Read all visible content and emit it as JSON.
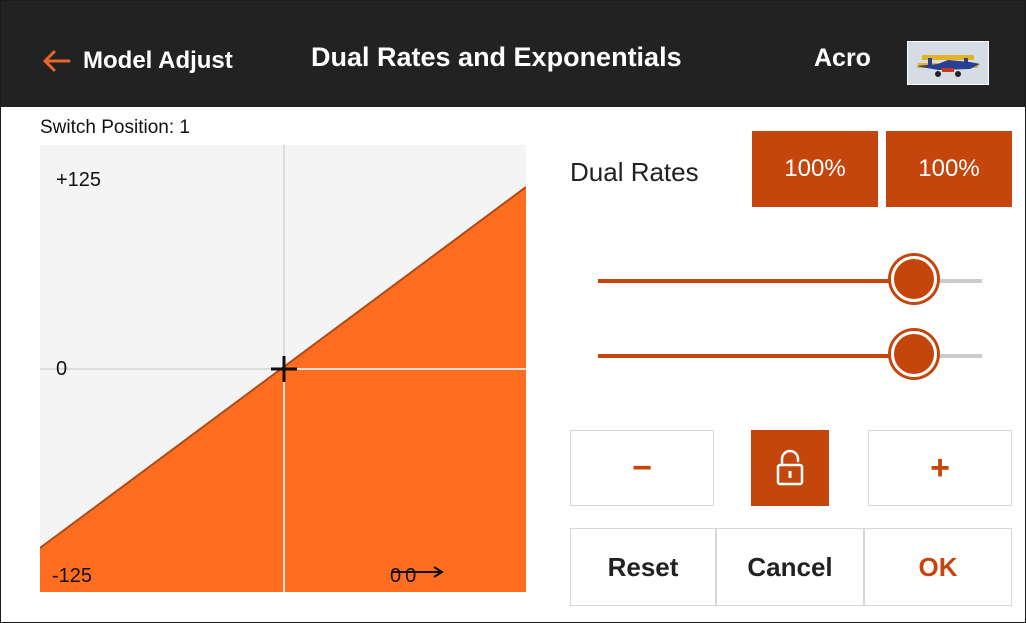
{
  "header": {
    "back_label": "Model Adjust",
    "title": "Dual Rates and Exponentials",
    "model_name": "Acro",
    "back_icon": "arrow-left-icon",
    "accent": "#e8662a"
  },
  "graph": {
    "switch_position": "Switch Position: 1",
    "y_max_label": "+125",
    "y_mid_label": "0",
    "y_min_label": "-125",
    "io_readout": {
      "input": "0",
      "output": "0"
    },
    "fill_color": "#ff6e20"
  },
  "dual_rates": {
    "label": "Dual Rates",
    "rate_1": "100%",
    "rate_2": "100%"
  },
  "sliders": [
    {
      "name": "dual-rate-slider",
      "level": 0.82
    },
    {
      "name": "expo-slider",
      "level": 0.82
    }
  ],
  "controls": {
    "minus_label": "−",
    "plus_label": "+",
    "lock_icon": "padlock-unlocked-icon",
    "reset_label": "Reset",
    "cancel_label": "Cancel",
    "ok_label": "OK"
  },
  "colors": {
    "accent_dark": "#c4460d",
    "topbar": "#222222"
  }
}
